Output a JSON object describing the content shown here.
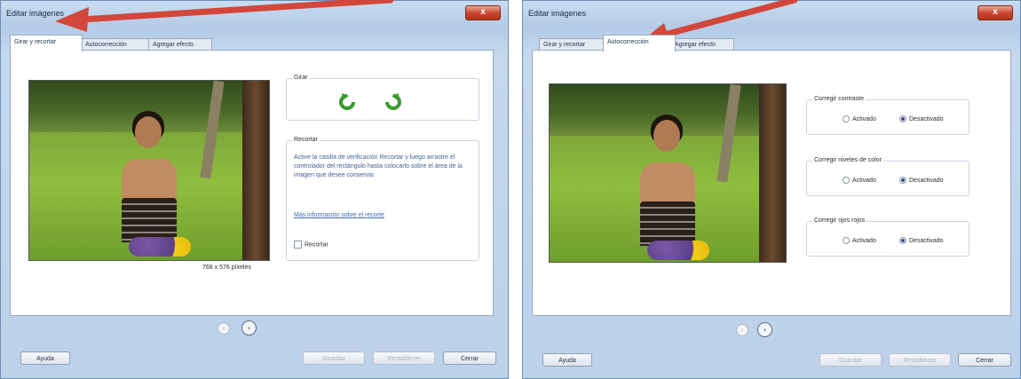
{
  "left": {
    "title": "Editar imágenes",
    "close_label": "x",
    "tabs": [
      "Girar y recortar",
      "Autocorrección",
      "Agregar efecto"
    ],
    "rotate_group": {
      "title": "Girar"
    },
    "crop_group": {
      "title": "Recortar",
      "description": "Active la casilla de verificación Recortar y luego arrastre el controlador del rectángulo hasta colocarlo sobre el área de la imagen que desee conservar.",
      "link": "Más información sobre el recorte",
      "checkbox_label": "Recortar"
    },
    "image_caption": "768 x 576 píxeles",
    "nav": {
      "prev": "‹",
      "next": "›"
    },
    "buttons": {
      "help": "Ayuda",
      "save": "Guardar",
      "reset": "Restablecer",
      "close": "Cerrar"
    }
  },
  "right": {
    "title": "Editar imágenes",
    "close_label": "x",
    "tabs": [
      "Girar y recortar",
      "Autocorrección",
      "Agregar efecto"
    ],
    "groups": [
      {
        "title": "Corregir contraste",
        "on": "Activado",
        "off": "Desactivado"
      },
      {
        "title": "Corregir niveles de color",
        "on": "Activado",
        "off": "Desactivado"
      },
      {
        "title": "Corregir ojos rojos",
        "on": "Activado",
        "off": "Desactivado"
      }
    ],
    "nav": {
      "prev": "‹",
      "next": "›"
    },
    "buttons": {
      "help": "Ayuda",
      "save": "Guardar",
      "reset": "Restablecer",
      "close": "Cerrar"
    }
  },
  "colors": {
    "arrow": "#d2473a",
    "window_border": "#6d8fb5",
    "accent_blue": "#3f68b4"
  }
}
